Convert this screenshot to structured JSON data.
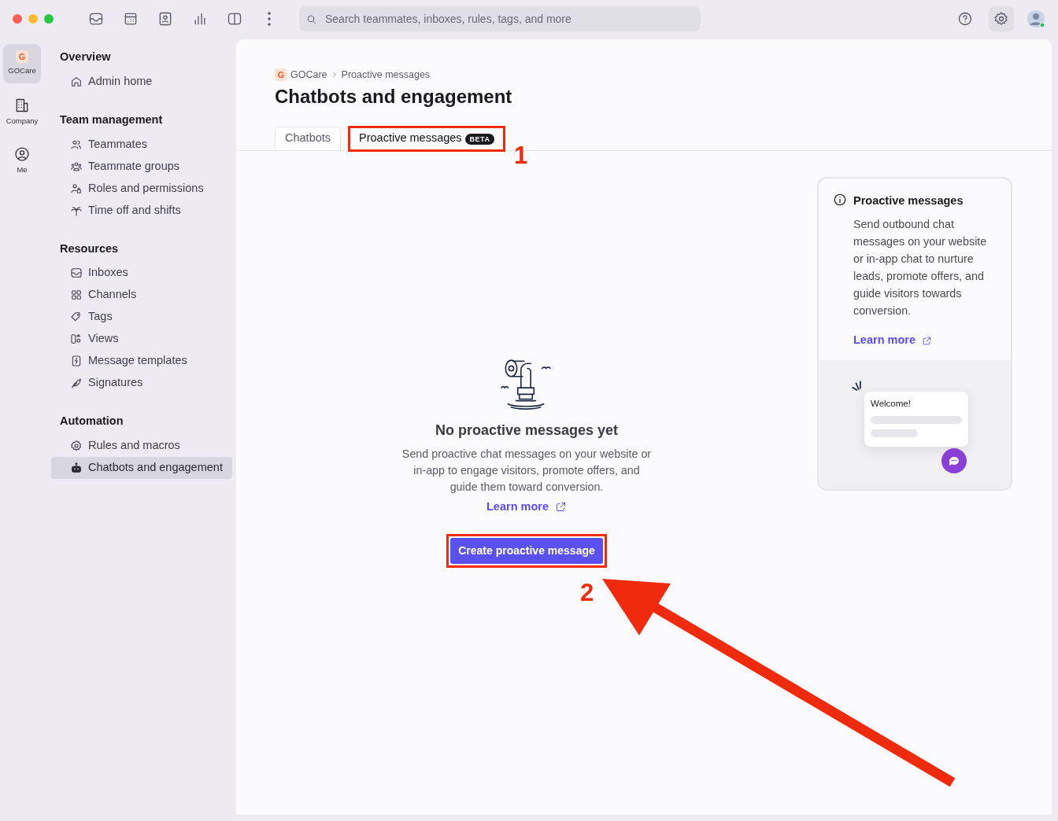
{
  "toolbar": {
    "search": {
      "placeholder": "Search teammates, inboxes, rules, tags, and more"
    }
  },
  "rail": [
    {
      "label": "GOCare",
      "logo": "G",
      "selected": true
    },
    {
      "label": "Company",
      "selected": false
    },
    {
      "label": "Me",
      "selected": false
    }
  ],
  "sidebar": {
    "sections": [
      {
        "title": "Overview",
        "items": [
          {
            "label": "Admin home",
            "selected": false
          }
        ]
      },
      {
        "title": "Team management",
        "items": [
          {
            "label": "Teammates",
            "selected": false
          },
          {
            "label": "Teammate groups",
            "selected": false
          },
          {
            "label": "Roles and permissions",
            "selected": false
          },
          {
            "label": "Time off and shifts",
            "selected": false
          }
        ]
      },
      {
        "title": "Resources",
        "items": [
          {
            "label": "Inboxes",
            "selected": false
          },
          {
            "label": "Channels",
            "selected": false
          },
          {
            "label": "Tags",
            "selected": false
          },
          {
            "label": "Views",
            "selected": false
          },
          {
            "label": "Message templates",
            "selected": false
          },
          {
            "label": "Signatures",
            "selected": false
          }
        ]
      },
      {
        "title": "Automation",
        "items": [
          {
            "label": "Rules and macros",
            "selected": false
          },
          {
            "label": "Chatbots and engagement",
            "selected": true
          }
        ]
      }
    ]
  },
  "breadcrumb": {
    "logo": "G",
    "items": [
      "GOCare",
      "Proactive messages"
    ]
  },
  "title": "Chatbots and engagement",
  "tabs": [
    {
      "label": "Chatbots",
      "selected": false
    },
    {
      "label": "Proactive messages",
      "badge": "BETA",
      "selected": true
    }
  ],
  "empty_state": {
    "title": "No proactive messages yet",
    "text": "Send proactive chat messages on your website or in-app to engage visitors, promote offers, and guide them toward conversion.",
    "link": "Learn more",
    "button": "Create proactive message"
  },
  "info_card": {
    "title": "Proactive messages",
    "text": "Send outbound chat messages on your website or in-app chat to nurture leads, promote offers, and guide visitors towards conversion.",
    "link": "Learn more",
    "preview": {
      "greeting": "Welcome!"
    }
  },
  "annotations": [
    {
      "number": "1"
    },
    {
      "number": "2"
    }
  ]
}
